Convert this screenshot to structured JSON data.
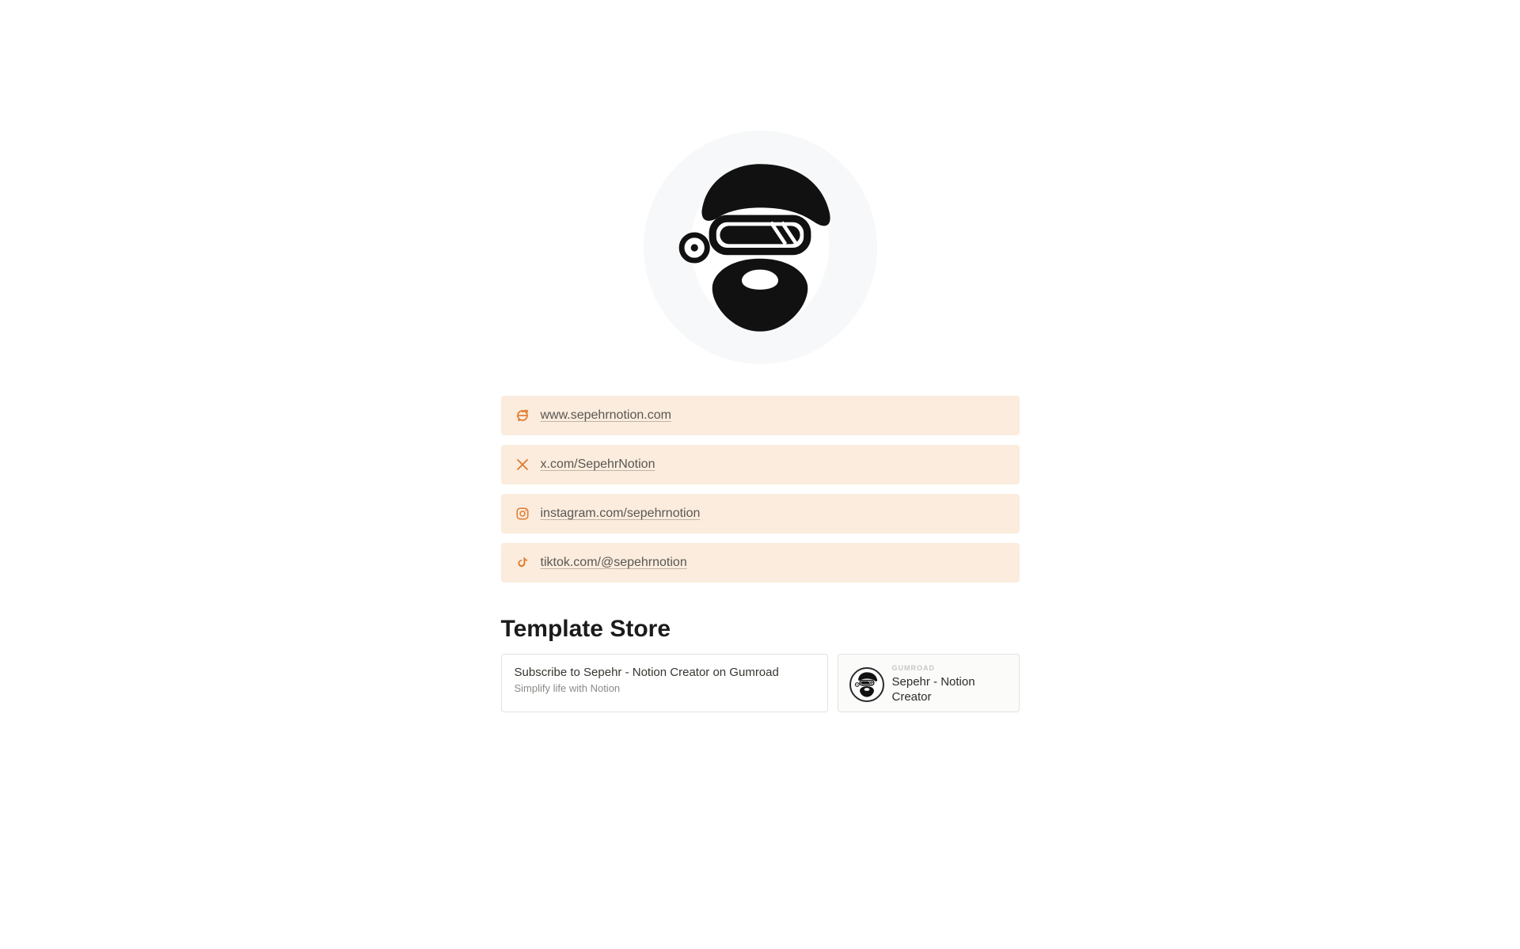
{
  "links": [
    {
      "icon": "ie",
      "label": "www.sepehrnotion.com"
    },
    {
      "icon": "x",
      "label": "x.com/SepehrNotion"
    },
    {
      "icon": "instagram",
      "label": "instagram.com/sepehrnotion"
    },
    {
      "icon": "tiktok",
      "label": "tiktok.com/@sepehrnotion"
    }
  ],
  "heading": "Template Store",
  "store": {
    "left": {
      "title": "Subscribe to Sepehr - Notion Creator on Gumroad",
      "subtitle": "Simplify life with Notion"
    },
    "right": {
      "brand": "GUMROAD",
      "name": "Sepehr - Notion Creator"
    }
  },
  "accent": "#e07a2c"
}
